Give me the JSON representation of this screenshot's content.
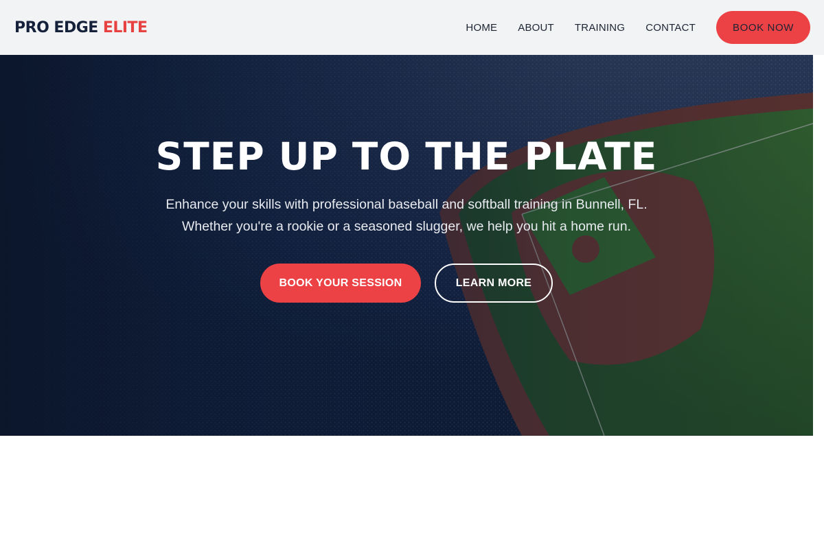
{
  "brand": {
    "name_part1": "PRO EDGE",
    "name_part2": "ELITE",
    "accent_color": "#e84141"
  },
  "nav": {
    "items": [
      {
        "label": "HOME"
      },
      {
        "label": "ABOUT"
      },
      {
        "label": "TRAINING"
      },
      {
        "label": "CONTACT"
      }
    ],
    "cta_label": "BOOK NOW"
  },
  "hero": {
    "title": "STEP UP TO THE PLATE",
    "subtitle_line1": "Enhance your skills with professional baseball and softball training in Bunnell, FL.",
    "subtitle_line2": "Whether you're a rookie or a seasoned slugger, we help you hit a home run.",
    "primary_cta": "BOOK YOUR SESSION",
    "secondary_cta": "LEARN MORE",
    "background": "baseball-stadium-aerial-image"
  },
  "colors": {
    "primary": "#ec4145",
    "dark_navy": "#15213a",
    "header_bg": "#f2f3f4"
  }
}
